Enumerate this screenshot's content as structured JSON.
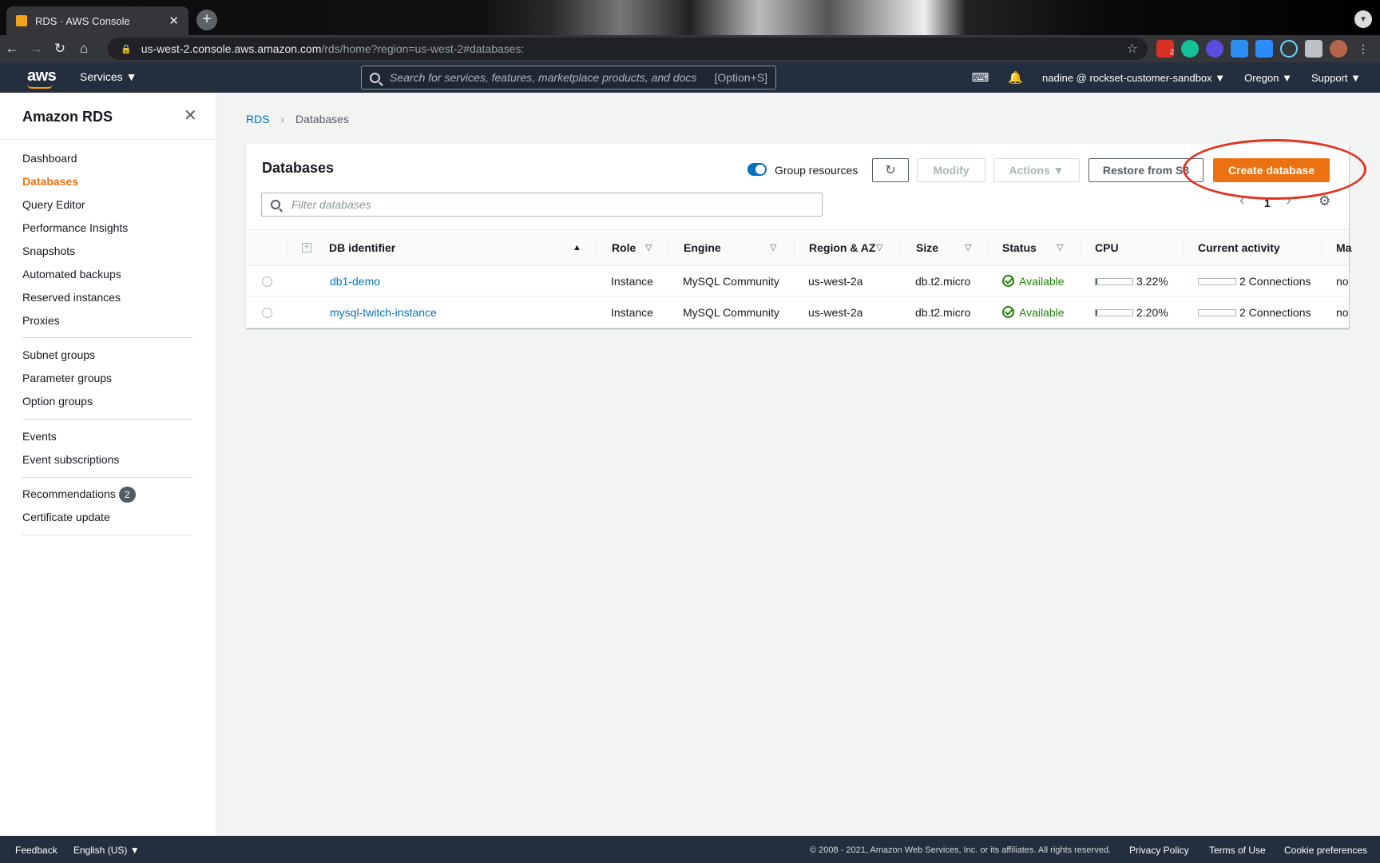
{
  "browser": {
    "tab_title": "RDS · AWS Console",
    "tab_close": "✕",
    "new_tab": "+",
    "url_host": "us-west-2.console.aws.amazon.com",
    "url_path": "/rds/home?region=us-west-2#databases:",
    "ext_badge": "2"
  },
  "header": {
    "logo": "aws",
    "services": "Services ▼",
    "search_placeholder": "Search for services, features, marketplace products, and docs",
    "search_shortcut": "[Option+S]",
    "account": "nadine @ rockset-customer-sandbox ▼",
    "region": "Oregon ▼",
    "support": "Support ▼"
  },
  "sidenav": {
    "title": "Amazon RDS",
    "close": "✕",
    "section1": [
      "Dashboard",
      "Databases",
      "Query Editor",
      "Performance Insights",
      "Snapshots",
      "Automated backups",
      "Reserved instances",
      "Proxies"
    ],
    "section2": [
      "Subnet groups",
      "Parameter groups",
      "Option groups"
    ],
    "section3": [
      "Events",
      "Event subscriptions"
    ],
    "section4": {
      "recommendations": "Recommendations",
      "recommendations_count": "2",
      "certificate": "Certificate update"
    }
  },
  "breadcrumb": {
    "root": "RDS",
    "current": "Databases"
  },
  "panel": {
    "title": "Databases",
    "group_resources": "Group resources",
    "refresh": "↻",
    "modify": "Modify",
    "actions": "Actions ▼",
    "restore": "Restore from S3",
    "create": "Create database",
    "filter_placeholder": "Filter databases",
    "page": "1",
    "prev": "‹",
    "next": "›",
    "settings": "⚙"
  },
  "table": {
    "expand": "+",
    "headers": {
      "id": "DB identifier",
      "role": "Role",
      "engine": "Engine",
      "region": "Region & AZ",
      "size": "Size",
      "status": "Status",
      "cpu": "CPU",
      "activity": "Current activity",
      "maint": "Ma"
    },
    "sort_asc": "▲",
    "sort_filter": "▽",
    "rows": [
      {
        "id": "db1-demo",
        "role": "Instance",
        "engine": "MySQL Community",
        "region": "us-west-2a",
        "size": "db.t2.micro",
        "status": "Available",
        "cpu": "3.22%",
        "cpu_value": 3.22,
        "activity": "2 Connections",
        "maint": "no"
      },
      {
        "id": "mysql-twitch-instance",
        "role": "Instance",
        "engine": "MySQL Community",
        "region": "us-west-2a",
        "size": "db.t2.micro",
        "status": "Available",
        "cpu": "2.20%",
        "cpu_value": 2.2,
        "activity": "2 Connections",
        "maint": "no"
      }
    ]
  },
  "footer": {
    "feedback": "Feedback",
    "language": "English (US) ▼",
    "copyright": "© 2008 - 2021, Amazon Web Services, Inc. or its affiliates. All rights reserved.",
    "privacy": "Privacy Policy",
    "terms": "Terms of Use",
    "cookies": "Cookie preferences"
  },
  "colors": {
    "accent": "#ec7211",
    "link": "#0073bb",
    "ok": "#1d8102",
    "annotation": "#e0321f"
  }
}
